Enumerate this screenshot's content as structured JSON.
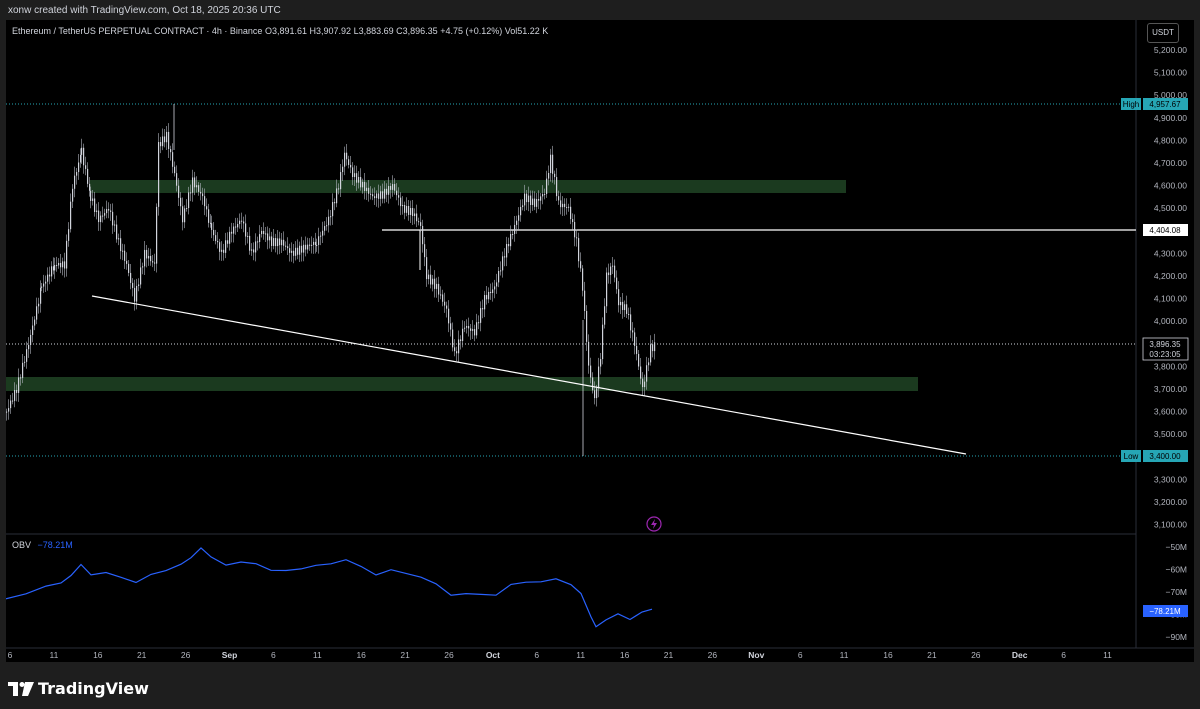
{
  "header": {
    "created_by": "xonw created with TradingView.com, Oct 18, 2025 20:36 UTC"
  },
  "symbol_info": {
    "title": "Ethereum / TetherUS PERPETUAL CONTRACT · 4h · Binance",
    "open": "O3,891.61",
    "high": "H3,907.92",
    "low": "L3,883.69",
    "close": "C3,896.35",
    "change": "+4.75 (+0.12%)",
    "volume": "Vol51.22 K"
  },
  "currency_button": "USDT",
  "price_axis": {
    "ticks": [
      "5,200.00",
      "5,100.00",
      "5,000.00",
      "4,900.00",
      "4,800.00",
      "4,700.00",
      "4,600.00",
      "4,500.00",
      "4,400.00",
      "4,300.00",
      "4,200.00",
      "4,100.00",
      "4,000.00",
      "3,900.00",
      "3,800.00",
      "3,700.00",
      "3,600.00",
      "3,500.00",
      "3,400.00",
      "3,300.00",
      "3,200.00",
      "3,100.00"
    ],
    "high_label": "High",
    "high_value": "4,957.67",
    "low_label": "Low",
    "low_value": "3,400.00",
    "level_value": "4,404.08",
    "last_price": "3,896.35",
    "countdown": "03:23:05"
  },
  "obv": {
    "name": "OBV",
    "value": "−78.21M",
    "ticks": [
      "−50M",
      "−60M",
      "−70M",
      "−80M",
      "−90M"
    ],
    "badge": "−78.21M"
  },
  "time_axis": {
    "labels": [
      "6",
      "11",
      "16",
      "21",
      "26",
      "Sep",
      "6",
      "11",
      "16",
      "21",
      "26",
      "Oct",
      "6",
      "11",
      "16",
      "21",
      "26",
      "Nov",
      "6",
      "11",
      "16",
      "21",
      "26",
      "Dec",
      "6",
      "11"
    ]
  },
  "footer": {
    "brand": "TradingView"
  },
  "colors": {
    "background": "#000000",
    "candle": "#d1d4dc",
    "zone": "#1b3a1f",
    "obv_line": "#2962ff",
    "high_low_badge": "#26a6b5",
    "lightning": "#9c27b0"
  },
  "chart_data": {
    "type": "candlestick",
    "interval": "4h",
    "x": [
      "Aug 6",
      "Aug 11",
      "Aug 16",
      "Aug 21",
      "Aug 26",
      "Sep 1",
      "Sep 6",
      "Sep 11",
      "Sep 16",
      "Sep 21",
      "Sep 26",
      "Oct 1",
      "Oct 6",
      "Oct 11",
      "Oct 16",
      "Oct 18"
    ],
    "close": [
      3550,
      4300,
      4550,
      4200,
      4650,
      4400,
      4300,
      4500,
      4550,
      4500,
      3900,
      4350,
      4600,
      3800,
      3850,
      3896.35
    ],
    "period_high": 4957.67,
    "period_low": 3400.0,
    "horizontal_level": 4404.08,
    "last_price": 3896.35,
    "zones": [
      {
        "from": 4570,
        "to": 4620
      },
      {
        "from": 3700,
        "to": 3760
      }
    ],
    "trendline": {
      "from": [
        "Aug 14",
        4110
      ],
      "to": [
        "Nov 23",
        3400
      ]
    },
    "ylim": [
      3060,
      5260
    ],
    "obv": {
      "x": [
        "Aug 6",
        "Aug 11",
        "Aug 16",
        "Aug 21",
        "Aug 26",
        "Sep 6",
        "Sep 11",
        "Sep 16",
        "Sep 21",
        "Sep 26",
        "Oct 1",
        "Oct 6",
        "Oct 11",
        "Oct 16",
        "Oct 18"
      ],
      "values": [
        -66,
        -58,
        -54,
        -60,
        -52,
        -57,
        -55,
        -58,
        -62,
        -67,
        -64,
        -61,
        -87,
        -83,
        -78.21
      ],
      "ylim": [
        -93,
        -47
      ]
    }
  }
}
